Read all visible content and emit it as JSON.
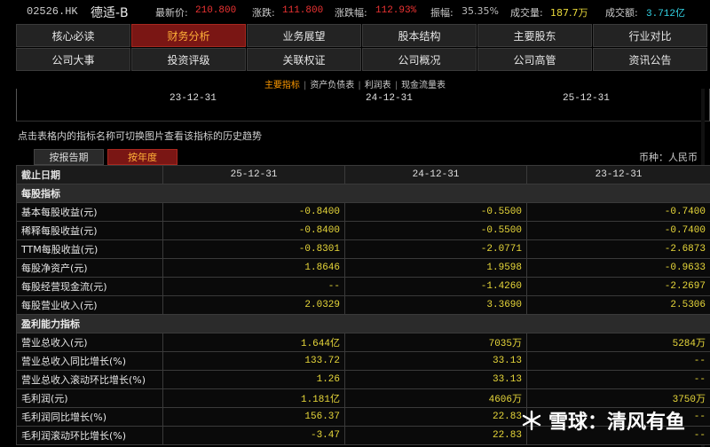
{
  "quote": {
    "code": "02526.HK",
    "name": "德适-B",
    "latest_label": "最新价:",
    "latest_value": "210.800",
    "change_label": "涨跌:",
    "change_value": "111.800",
    "change_pct_label": "涨跌幅:",
    "change_pct_value": "112.93%",
    "amplitude_label": "振幅:",
    "amplitude_value": "35.35%",
    "volume_label": "成交量:",
    "volume_value": "187.7万",
    "turnover_label": "成交额:",
    "turnover_value": "3.712亿"
  },
  "nav": {
    "row1": [
      "核心必读",
      "财务分析",
      "业务展望",
      "股本结构",
      "主要股东",
      "行业对比"
    ],
    "row2": [
      "公司大事",
      "投资评级",
      "关联权证",
      "公司概况",
      "公司高管",
      "资讯公告"
    ],
    "active": "财务分析"
  },
  "subtabs": [
    "主要指标",
    "资产负债表",
    "利润表",
    "现金流量表"
  ],
  "chart_dates": [
    "23-12-31",
    "24-12-31",
    "25-12-31"
  ],
  "hint": "点击表格内的指标名称可切换图片查看该指标的历史趋势",
  "period_tabs": {
    "report": "按报告期",
    "annual": "按年度"
  },
  "currency": "币种：人民币",
  "table": {
    "header": [
      "截止日期",
      "25-12-31",
      "24-12-31",
      "23-12-31"
    ],
    "s1": "每股指标",
    "r1": [
      "基本每股收益(元)",
      "-0.8400",
      "-0.5500",
      "-0.7400"
    ],
    "r2": [
      "稀释每股收益(元)",
      "-0.8400",
      "-0.5500",
      "-0.7400"
    ],
    "r3": [
      "TTM每股收益(元)",
      "-0.8301",
      "-2.0771",
      "-2.6873"
    ],
    "r4": [
      "每股净资产(元)",
      "1.8646",
      "1.9598",
      "-0.9633"
    ],
    "r5": [
      "每股经营现金流(元)",
      "--",
      "-1.4260",
      "-2.2697"
    ],
    "r6": [
      "每股营业收入(元)",
      "2.0329",
      "3.3690",
      "2.5306"
    ],
    "s2": "盈利能力指标",
    "r7": [
      "营业总收入(元)",
      "1.644亿",
      "7035万",
      "5284万"
    ],
    "r8": [
      "营业总收入同比增长(%)",
      "133.72",
      "33.13",
      "--"
    ],
    "r9": [
      "营业总收入滚动环比增长(%)",
      "1.26",
      "33.13",
      "--"
    ],
    "r10": [
      "毛利润(元)",
      "1.181亿",
      "4606万",
      "3750万"
    ],
    "r11": [
      "毛利润同比增长(%)",
      "156.37",
      "22.83",
      "--"
    ],
    "r12": [
      "毛利润滚动环比增长(%)",
      "-3.47",
      "22.83",
      "--"
    ]
  },
  "watermark": "雪球：清风有鱼"
}
